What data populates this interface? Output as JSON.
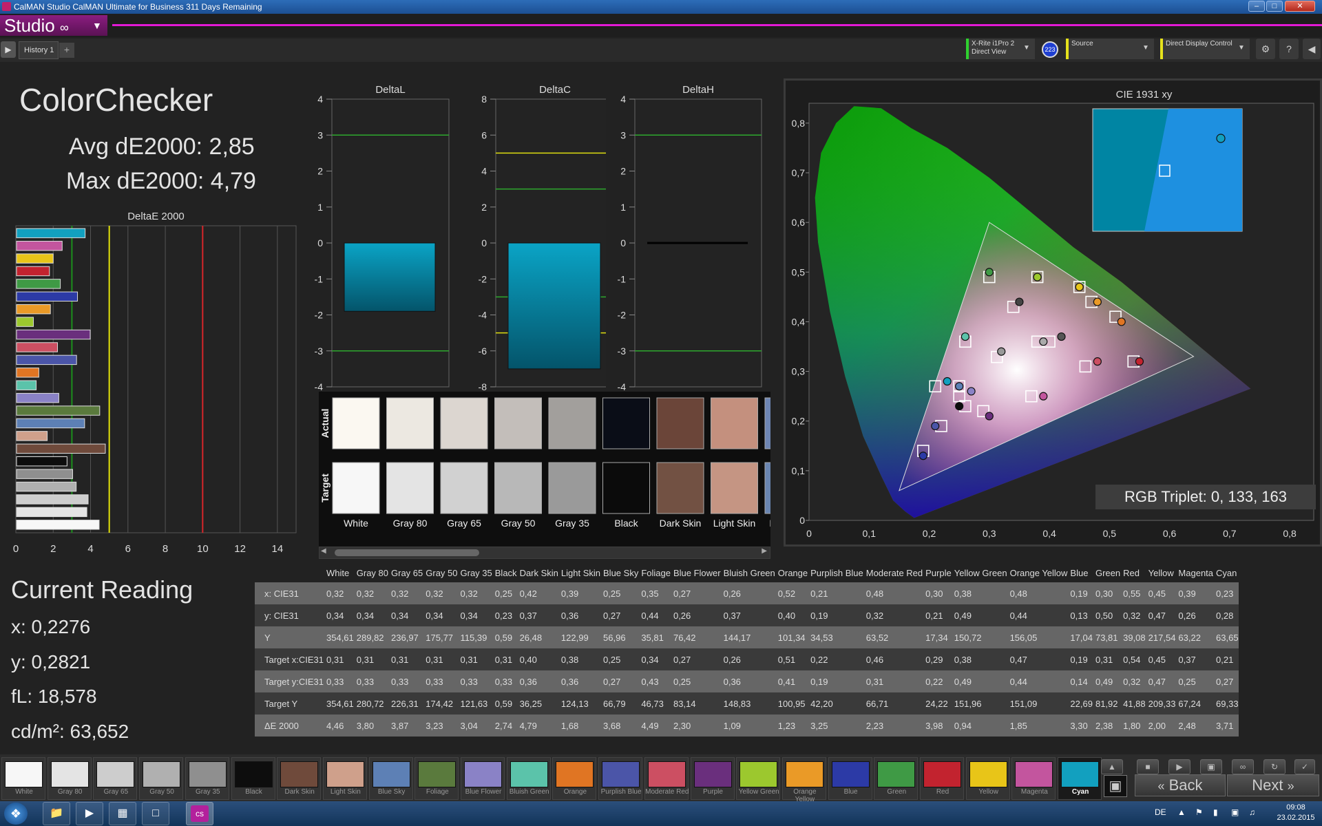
{
  "window": {
    "title": "CalMAN Studio CalMAN Ultimate for Business 311 Days Remaining"
  },
  "toolbar": {
    "studio_label": "Studio",
    "tab_label": "History 1",
    "meter": {
      "line1": "X-Rite i1Pro 2",
      "line2": "Direct View",
      "badge": "223"
    },
    "source": "Source",
    "display": "Direct Display Control"
  },
  "summary": {
    "title": "ColorChecker",
    "avg": "Avg dE2000: 2,85",
    "max": "Max dE2000: 4,79"
  },
  "reading": {
    "title": "Current Reading",
    "x": "x: 0,2276",
    "y": "y: 0,2821",
    "fl": "fL: 18,578",
    "cdm": "cd/m²: 63,652"
  },
  "chart_data": [
    {
      "type": "bar",
      "title": "DeltaE 2000",
      "orientation": "horizontal",
      "xticks": [
        "0",
        "2",
        "4",
        "6",
        "8",
        "10",
        "12",
        "14"
      ],
      "xlim": [
        0,
        15
      ],
      "threshold_lines": [
        {
          "value": 3,
          "color": "#1c8f1c"
        },
        {
          "value": 5,
          "color": "#e3e30a"
        },
        {
          "value": 10,
          "color": "#d8262a"
        }
      ],
      "categories": [
        "Cyan",
        "Magenta",
        "Yellow",
        "Red",
        "Green",
        "Blue",
        "Orange Yellow",
        "Yellow Green",
        "Purple",
        "Moderate Red",
        "Purplish Blue",
        "Orange",
        "Bluish Green",
        "Blue Flower",
        "Foliage",
        "Blue Sky",
        "Light Skin",
        "Dark Skin",
        "Black",
        "Gray 35",
        "Gray 50",
        "Gray 65",
        "Gray 80",
        "White"
      ],
      "values": [
        3.71,
        2.48,
        2.0,
        1.8,
        2.38,
        3.3,
        1.85,
        0.94,
        3.98,
        2.23,
        3.25,
        1.23,
        1.09,
        2.3,
        4.49,
        3.68,
        1.68,
        4.79,
        2.74,
        3.04,
        3.23,
        3.87,
        3.8,
        4.46
      ],
      "colors": [
        "#12a0bf",
        "#c3559e",
        "#e8c518",
        "#c2232f",
        "#3f9a45",
        "#2c3aa6",
        "#ea9a27",
        "#9cc82e",
        "#6a2f7d",
        "#cc4f62",
        "#4b55a8",
        "#e07523",
        "#5bc3aa",
        "#8a82c6",
        "#5a7a3d",
        "#5d80b5",
        "#cfa08b",
        "#6f4a3b",
        "#0d0d0d",
        "#8f8f8f",
        "#b0b0b0",
        "#cdcdcd",
        "#e4e4e4",
        "#f7f7f7"
      ]
    },
    {
      "type": "bar",
      "title": "DeltaL",
      "yticks": [
        "4",
        "3",
        "2",
        "1",
        "0",
        "-1",
        "-2",
        "-3",
        "-4"
      ],
      "ylim": [
        -4,
        4
      ],
      "values": [
        -1.9
      ],
      "lines": [
        {
          "value": 3,
          "color": "#2eaa2e"
        },
        {
          "value": -3,
          "color": "#2eaa2e"
        }
      ]
    },
    {
      "type": "bar",
      "title": "DeltaC",
      "yticks": [
        "8",
        "6",
        "4",
        "2",
        "0",
        "-2",
        "-4",
        "-6",
        "-8"
      ],
      "ylim": [
        -8,
        8
      ],
      "values": [
        -7.0
      ],
      "lines": [
        {
          "value": 5,
          "color": "#e0e010"
        },
        {
          "value": 3,
          "color": "#2eaa2e"
        },
        {
          "value": -3,
          "color": "#2eaa2e"
        },
        {
          "value": -5,
          "color": "#e0e010"
        }
      ]
    },
    {
      "type": "bar",
      "title": "DeltaH",
      "yticks": [
        "4",
        "3",
        "2",
        "1",
        "0",
        "-1",
        "-2",
        "-3",
        "-4"
      ],
      "ylim": [
        -4,
        4
      ],
      "values": [
        0.0
      ],
      "lines": [
        {
          "value": 3,
          "color": "#2eaa2e"
        },
        {
          "value": -3,
          "color": "#2eaa2e"
        }
      ]
    },
    {
      "type": "scatter",
      "title": "CIE 1931 xy",
      "xticks": [
        "0",
        "0,1",
        "0,2",
        "0,3",
        "0,4",
        "0,5",
        "0,6",
        "0,7",
        "0,8"
      ],
      "yticks": [
        "0",
        "0,1",
        "0,2",
        "0,3",
        "0,4",
        "0,5",
        "0,6",
        "0,7",
        "0,8"
      ],
      "xlim": [
        0,
        0.84
      ],
      "ylim": [
        0,
        0.84
      ],
      "gamut": [
        [
          0.64,
          0.33
        ],
        [
          0.3,
          0.6
        ],
        [
          0.15,
          0.06
        ]
      ],
      "targets": [
        [
          0.3127,
          0.329
        ],
        [
          0.4,
          0.36
        ],
        [
          0.38,
          0.36
        ],
        [
          0.25,
          0.27
        ],
        [
          0.34,
          0.43
        ],
        [
          0.25,
          0.25
        ],
        [
          0.26,
          0.36
        ],
        [
          0.51,
          0.41
        ],
        [
          0.22,
          0.19
        ],
        [
          0.46,
          0.31
        ],
        [
          0.29,
          0.22
        ],
        [
          0.38,
          0.49
        ],
        [
          0.47,
          0.44
        ],
        [
          0.19,
          0.14
        ],
        [
          0.3,
          0.49
        ],
        [
          0.54,
          0.32
        ],
        [
          0.45,
          0.47
        ],
        [
          0.37,
          0.25
        ],
        [
          0.21,
          0.27
        ],
        [
          0.26,
          0.23
        ]
      ],
      "actual": [
        [
          0.32,
          0.34
        ],
        [
          0.25,
          0.23
        ],
        [
          0.42,
          0.37
        ],
        [
          0.39,
          0.36
        ],
        [
          0.25,
          0.27
        ],
        [
          0.35,
          0.44
        ],
        [
          0.27,
          0.26
        ],
        [
          0.26,
          0.37
        ],
        [
          0.52,
          0.4
        ],
        [
          0.21,
          0.19
        ],
        [
          0.48,
          0.32
        ],
        [
          0.3,
          0.21
        ],
        [
          0.38,
          0.49
        ],
        [
          0.48,
          0.44
        ],
        [
          0.19,
          0.13
        ],
        [
          0.3,
          0.5
        ],
        [
          0.55,
          0.32
        ],
        [
          0.45,
          0.47
        ],
        [
          0.39,
          0.25
        ],
        [
          0.23,
          0.28
        ]
      ],
      "actual_colors": [
        "#999",
        "#0d0d0d",
        "#555",
        "#aaa",
        "#5d80b5",
        "#444",
        "#8a82c6",
        "#5bc3aa",
        "#e07523",
        "#4b55a8",
        "#cc4f62",
        "#6a2f7d",
        "#9cc82e",
        "#ea9a27",
        "#2c3aa6",
        "#3f9a45",
        "#c2232f",
        "#e8c518",
        "#c3559e",
        "#12a0bf"
      ],
      "inset_color": "#0085a3"
    }
  ],
  "rgb_triplet": "RGB Triplet: 0, 133, 163",
  "swatches": {
    "actual_label": "Actual",
    "target_label": "Target",
    "items": [
      {
        "label": "White",
        "actual": "#fbf8f1",
        "target": "#f7f7f7"
      },
      {
        "label": "Gray 80",
        "actual": "#ece8e1",
        "target": "#e4e4e4"
      },
      {
        "label": "Gray 65",
        "actual": "#dcd6d0",
        "target": "#d1d1d1"
      },
      {
        "label": "Gray 50",
        "actual": "#c3beba",
        "target": "#b8b8b8"
      },
      {
        "label": "Gray 35",
        "actual": "#a29f9c",
        "target": "#9a9a9a"
      },
      {
        "label": "Black",
        "actual": "#0a0d17",
        "target": "#0b0b0b"
      },
      {
        "label": "Dark Skin",
        "actual": "#6b4539",
        "target": "#725143"
      },
      {
        "label": "Light Skin",
        "actual": "#c4907e",
        "target": "#c59583"
      },
      {
        "label": "Blue Sky",
        "actual": "#6e86b4",
        "target": "#6a86b2"
      }
    ]
  },
  "table": {
    "columns": [
      "",
      "White",
      "Gray 80",
      "Gray 65",
      "Gray 50",
      "Gray 35",
      "Black",
      "Dark Skin",
      "Light Skin",
      "Blue Sky",
      "Foliage",
      "Blue Flower",
      "Bluish Green",
      "Orange",
      "Purplish Blue",
      "Moderate Red",
      "Purple",
      "Yellow Green",
      "Orange Yellow",
      "Blue",
      "Green",
      "Red",
      "Yellow",
      "Magenta",
      "Cyan"
    ],
    "rows": [
      [
        "x: CIE31",
        "0,32",
        "0,32",
        "0,32",
        "0,32",
        "0,32",
        "0,25",
        "0,42",
        "0,39",
        "0,25",
        "0,35",
        "0,27",
        "0,26",
        "0,52",
        "0,21",
        "0,48",
        "0,30",
        "0,38",
        "0,48",
        "0,19",
        "0,30",
        "0,55",
        "0,45",
        "0,39",
        "0,23"
      ],
      [
        "y: CIE31",
        "0,34",
        "0,34",
        "0,34",
        "0,34",
        "0,34",
        "0,23",
        "0,37",
        "0,36",
        "0,27",
        "0,44",
        "0,26",
        "0,37",
        "0,40",
        "0,19",
        "0,32",
        "0,21",
        "0,49",
        "0,44",
        "0,13",
        "0,50",
        "0,32",
        "0,47",
        "0,26",
        "0,28"
      ],
      [
        "Y",
        "354,61",
        "289,82",
        "236,97",
        "175,77",
        "115,39",
        "0,59",
        "26,48",
        "122,99",
        "56,96",
        "35,81",
        "76,42",
        "144,17",
        "101,34",
        "34,53",
        "63,52",
        "17,34",
        "150,72",
        "156,05",
        "17,04",
        "73,81",
        "39,08",
        "217,54",
        "63,22",
        "63,65"
      ],
      [
        "Target x:CIE31",
        "0,31",
        "0,31",
        "0,31",
        "0,31",
        "0,31",
        "0,31",
        "0,40",
        "0,38",
        "0,25",
        "0,34",
        "0,27",
        "0,26",
        "0,51",
        "0,22",
        "0,46",
        "0,29",
        "0,38",
        "0,47",
        "0,19",
        "0,31",
        "0,54",
        "0,45",
        "0,37",
        "0,21"
      ],
      [
        "Target y:CIE31",
        "0,33",
        "0,33",
        "0,33",
        "0,33",
        "0,33",
        "0,33",
        "0,36",
        "0,36",
        "0,27",
        "0,43",
        "0,25",
        "0,36",
        "0,41",
        "0,19",
        "0,31",
        "0,22",
        "0,49",
        "0,44",
        "0,14",
        "0,49",
        "0,32",
        "0,47",
        "0,25",
        "0,27"
      ],
      [
        "Target Y",
        "354,61",
        "280,72",
        "226,31",
        "174,42",
        "121,63",
        "0,59",
        "36,25",
        "124,13",
        "66,79",
        "46,73",
        "83,14",
        "148,83",
        "100,95",
        "42,20",
        "66,71",
        "24,22",
        "151,96",
        "151,09",
        "22,69",
        "81,92",
        "41,88",
        "209,33",
        "67,24",
        "69,33"
      ],
      [
        "ΔE 2000",
        "4,46",
        "3,80",
        "3,87",
        "3,23",
        "3,04",
        "2,74",
        "4,79",
        "1,68",
        "3,68",
        "4,49",
        "2,30",
        "1,09",
        "1,23",
        "3,25",
        "2,23",
        "3,98",
        "0,94",
        "1,85",
        "3,30",
        "2,38",
        "1,80",
        "2,00",
        "2,48",
        "3,71"
      ]
    ]
  },
  "bottom": {
    "swatches": [
      {
        "label": "White",
        "color": "#f7f7f7"
      },
      {
        "label": "Gray 80",
        "color": "#e4e4e4"
      },
      {
        "label": "Gray 65",
        "color": "#cdcdcd"
      },
      {
        "label": "Gray 50",
        "color": "#b0b0b0"
      },
      {
        "label": "Gray 35",
        "color": "#8f8f8f"
      },
      {
        "label": "Black",
        "color": "#0d0d0d"
      },
      {
        "label": "Dark Skin",
        "color": "#6f4a3b"
      },
      {
        "label": "Light Skin",
        "color": "#cfa08b"
      },
      {
        "label": "Blue Sky",
        "color": "#5d80b5"
      },
      {
        "label": "Foliage",
        "color": "#5a7a3d"
      },
      {
        "label": "Blue Flower",
        "color": "#8a82c6"
      },
      {
        "label": "Bluish Green",
        "color": "#5bc3aa"
      },
      {
        "label": "Orange",
        "color": "#e07523"
      },
      {
        "label": "Purplish Blue",
        "color": "#4b55a8"
      },
      {
        "label": "Moderate Red",
        "color": "#cc4f62"
      },
      {
        "label": "Purple",
        "color": "#6a2f7d"
      },
      {
        "label": "Yellow Green",
        "color": "#9cc82e"
      },
      {
        "label": "Orange Yellow",
        "color": "#ea9a27"
      },
      {
        "label": "Blue",
        "color": "#2c3aa6"
      },
      {
        "label": "Green",
        "color": "#3f9a45"
      },
      {
        "label": "Red",
        "color": "#c2232f"
      },
      {
        "label": "Yellow",
        "color": "#e8c518"
      },
      {
        "label": "Magenta",
        "color": "#c3559e"
      },
      {
        "label": "Cyan",
        "color": "#12a0bf"
      }
    ],
    "selected": "Cyan",
    "back_label": "Back",
    "next_label": "Next"
  },
  "taskbar": {
    "lang": "DE",
    "time": "09:08",
    "date": "23.02.2015"
  }
}
